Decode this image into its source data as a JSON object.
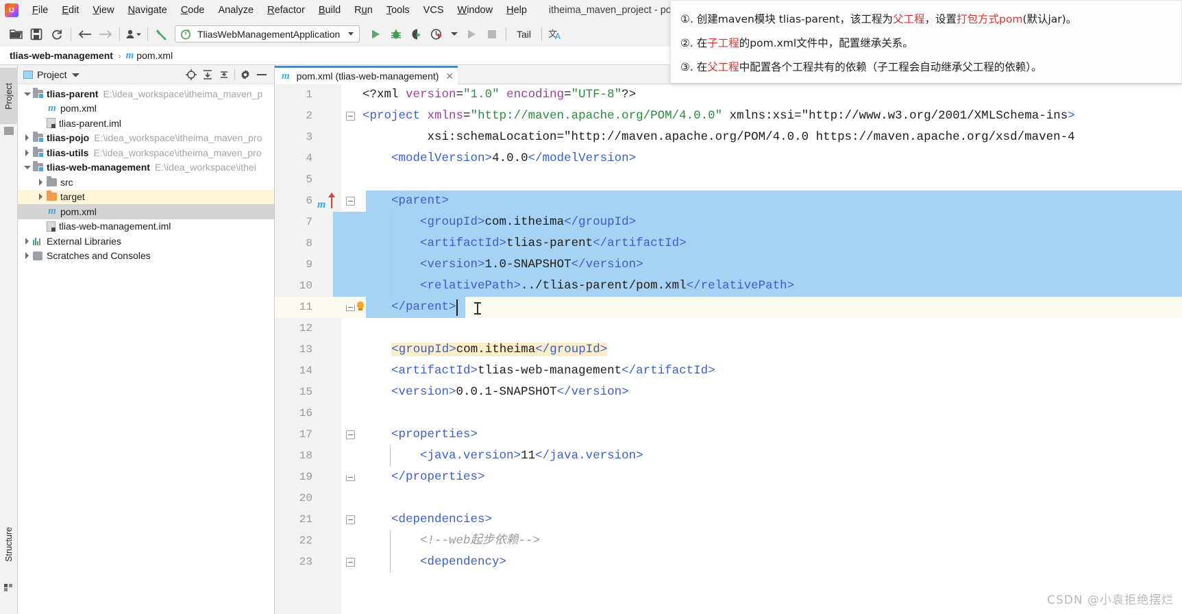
{
  "window": {
    "title": "itheima_maven_project - pom.xml (tlias-web-management)",
    "app_icon": "intellij-idea-logo"
  },
  "menubar": {
    "items": [
      {
        "label": "File",
        "mnemonic": "F"
      },
      {
        "label": "Edit",
        "mnemonic": "E"
      },
      {
        "label": "View",
        "mnemonic": "V"
      },
      {
        "label": "Navigate",
        "mnemonic": "N"
      },
      {
        "label": "Code",
        "mnemonic": "C"
      },
      {
        "label": "Analyze",
        "mnemonic": ""
      },
      {
        "label": "Refactor",
        "mnemonic": "R"
      },
      {
        "label": "Build",
        "mnemonic": "B"
      },
      {
        "label": "Run",
        "mnemonic": "u"
      },
      {
        "label": "Tools",
        "mnemonic": "T"
      },
      {
        "label": "VCS",
        "mnemonic": ""
      },
      {
        "label": "Window",
        "mnemonic": "W"
      },
      {
        "label": "Help",
        "mnemonic": "H"
      }
    ]
  },
  "toolbar": {
    "open_icon": "open-folder-icon",
    "save_icon": "save-disk-icon",
    "sync_icon": "refresh-sync-icon",
    "back_icon": "arrow-left-icon",
    "forward_icon": "arrow-right-icon",
    "profile_icon": "user-profile-icon",
    "build_icon": "hammer-build-icon",
    "run_config": "TliasWebManagementApplication",
    "run_icon": "run-play-icon",
    "debug_icon": "debug-bug-icon",
    "run_coverage_icon": "run-with-coverage-icon",
    "profiler_icon": "profiler-clock-icon",
    "rerun_icon": "rerun-play-icon",
    "stop_icon": "stop-square-icon",
    "tail_label": "Tail",
    "translate_icon": "translate-icon"
  },
  "breadcrumb": {
    "root": "tlias-web-management",
    "separator": "›",
    "file": "pom.xml",
    "file_icon": "maven-m-icon"
  },
  "left_strip": {
    "project_tab": "Project",
    "structure_tab": "Structure"
  },
  "project_panel": {
    "header_title": "Project",
    "header_icons": [
      "locate-target-icon",
      "expand-all-icon",
      "collapse-all-icon",
      "gear-settings-icon",
      "hide-minus-icon"
    ],
    "tree": [
      {
        "indent": 0,
        "arrow": "down",
        "icon": "module-folder",
        "name": "tlias-parent",
        "path": "E:\\idea_workspace\\itheima_maven_p",
        "bold": true,
        "state": "normal"
      },
      {
        "indent": 1,
        "arrow": "none",
        "icon": "maven-m",
        "name": "pom.xml",
        "path": "",
        "bold": false,
        "state": "normal"
      },
      {
        "indent": 1,
        "arrow": "none",
        "icon": "iml-file",
        "name": "tlias-parent.iml",
        "path": "",
        "bold": false,
        "state": "normal"
      },
      {
        "indent": 0,
        "arrow": "right",
        "icon": "module-folder",
        "name": "tlias-pojo",
        "path": "E:\\idea_workspace\\itheima_maven_pro",
        "bold": true,
        "state": "normal"
      },
      {
        "indent": 0,
        "arrow": "right",
        "icon": "module-folder",
        "name": "tlias-utils",
        "path": "E:\\idea_workspace\\itheima_maven_pro",
        "bold": true,
        "state": "normal"
      },
      {
        "indent": 0,
        "arrow": "down",
        "icon": "module-folder",
        "name": "tlias-web-management",
        "path": "E:\\idea_workspace\\ithei",
        "bold": true,
        "state": "normal"
      },
      {
        "indent": 1,
        "arrow": "right",
        "icon": "folder",
        "name": "src",
        "path": "",
        "bold": false,
        "state": "normal"
      },
      {
        "indent": 1,
        "arrow": "right",
        "icon": "folder-orange",
        "name": "target",
        "path": "",
        "bold": false,
        "state": "highlight"
      },
      {
        "indent": 1,
        "arrow": "none",
        "icon": "maven-m",
        "name": "pom.xml",
        "path": "",
        "bold": false,
        "state": "selected"
      },
      {
        "indent": 1,
        "arrow": "none",
        "icon": "iml-file",
        "name": "tlias-web-management.iml",
        "path": "",
        "bold": false,
        "state": "normal"
      },
      {
        "indent": 0,
        "arrow": "right",
        "icon": "library",
        "name": "External Libraries",
        "path": "",
        "bold": false,
        "state": "normal"
      },
      {
        "indent": 0,
        "arrow": "right",
        "icon": "scratch",
        "name": "Scratches and Consoles",
        "path": "",
        "bold": false,
        "state": "normal"
      }
    ]
  },
  "editor": {
    "tab": {
      "label": "pom.xml (tlias-web-management)",
      "icon": "maven-m-icon",
      "close_icon": "close-x-icon"
    },
    "lines": [
      {
        "num": 1,
        "text": "<?xml version=\"1.0\" encoding=\"UTF-8\"?>"
      },
      {
        "num": 2,
        "text": "<project xmlns=\"http://maven.apache.org/POM/4.0.0\" xmlns:xsi=\"http://www.w3.org/2001/XMLSchema-inst"
      },
      {
        "num": 3,
        "text": "         xsi:schemaLocation=\"http://maven.apache.org/POM/4.0.0 https://maven.apache.org/xsd/maven-4"
      },
      {
        "num": 4,
        "text": "    <modelVersion>4.0.0</modelVersion>"
      },
      {
        "num": 5,
        "text": ""
      },
      {
        "num": 6,
        "text": "    <parent>"
      },
      {
        "num": 7,
        "text": "        <groupId>com.itheima</groupId>"
      },
      {
        "num": 8,
        "text": "        <artifactId>tlias-parent</artifactId>"
      },
      {
        "num": 9,
        "text": "        <version>1.0-SNAPSHOT</version>"
      },
      {
        "num": 10,
        "text": "        <relativePath>../tlias-parent/pom.xml</relativePath>"
      },
      {
        "num": 11,
        "text": "    </parent>"
      },
      {
        "num": 12,
        "text": ""
      },
      {
        "num": 13,
        "text": "    <groupId>com.itheima</groupId>"
      },
      {
        "num": 14,
        "text": "    <artifactId>tlias-web-management</artifactId>"
      },
      {
        "num": 15,
        "text": "    <version>0.0.1-SNAPSHOT</version>"
      },
      {
        "num": 16,
        "text": ""
      },
      {
        "num": 17,
        "text": "    <properties>"
      },
      {
        "num": 18,
        "text": "        <java.version>11</java.version>"
      },
      {
        "num": 19,
        "text": "    </properties>"
      },
      {
        "num": 20,
        "text": ""
      },
      {
        "num": 21,
        "text": "    <dependencies>"
      },
      {
        "num": 22,
        "text": "        <!--web起步依赖-->"
      },
      {
        "num": 23,
        "text": "        <dependency>"
      }
    ],
    "selection_lines": [
      6,
      7,
      8,
      9,
      10,
      11
    ],
    "cursor_line": 11,
    "highlight_line": 13,
    "gutter_bulb_line": 11,
    "gutter_maven_marker_line": 6
  },
  "note_overlay": {
    "lines": [
      [
        {
          "t": "①. 创建maven模块 tlias-parent，该工程为",
          "c": "black"
        },
        {
          "t": "父工程",
          "c": "red"
        },
        {
          "t": "，设置",
          "c": "black"
        },
        {
          "t": "打包方式pom",
          "c": "red"
        },
        {
          "t": "(默认jar)。",
          "c": "black"
        }
      ],
      [
        {
          "t": "②. 在",
          "c": "black"
        },
        {
          "t": "子工程",
          "c": "red"
        },
        {
          "t": "的pom.xml文件中，配置继承关系。",
          "c": "black"
        }
      ],
      [
        {
          "t": "③. 在",
          "c": "black"
        },
        {
          "t": "父工程",
          "c": "red"
        },
        {
          "t": "中配置各个工程共有的依赖（子工程会自动继承父工程的依赖）。",
          "c": "black"
        }
      ]
    ]
  },
  "watermark": {
    "text": "CSDN @小袁拒绝摆烂"
  },
  "colors": {
    "selection": "#a6d2f4",
    "accent_blue": "#4a86c8",
    "maven_icon": "#3ba6dd",
    "tag": "#3a5fcd",
    "string": "#2a8a3e",
    "attribute": "#9b3fa0",
    "red_note": "#e03131",
    "highlight_yellow": "#fbeecb"
  }
}
